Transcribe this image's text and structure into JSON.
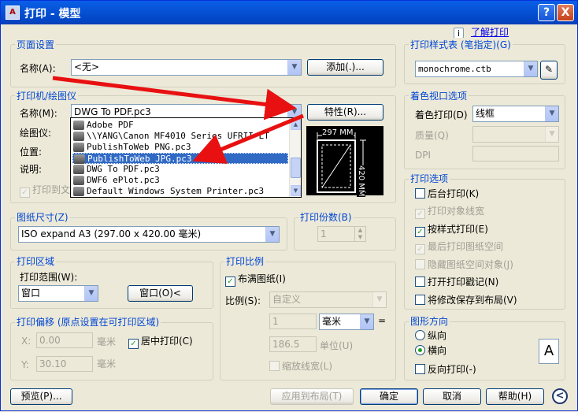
{
  "window": {
    "title": "打印 - 模型",
    "app_icon": "A",
    "min": "_",
    "close": "X"
  },
  "help": {
    "info": "i",
    "learn": "了解打印"
  },
  "page_setup": {
    "group": "页面设置",
    "name_label": "名称(A):",
    "name_value": "<无>",
    "add_button": "添加(.)..."
  },
  "printer": {
    "group": "打印机/绘图仪",
    "name_label": "名称(M):",
    "name_value": "DWG To PDF.pc3",
    "props_button": "特性(R)...",
    "plotter_label": "绘图仪:",
    "location_label": "位置:",
    "desc_label": "说明:",
    "print_to_file": "打印到文",
    "dropdown": [
      "Adobe PDF",
      "\\\\YANG\\Canon MF4010 Series UFRII LT",
      "PublishToWeb PNG.pc3",
      "PublishToWeb JPG.pc3",
      "DWG To PDF.pc3",
      "DWF6 ePlot.pc3",
      "Default Windows System Printer.pc3"
    ],
    "dropdown_selected": 3,
    "preview_width": "297 MM",
    "preview_height": "420 MM"
  },
  "paper_size": {
    "group": "图纸尺寸(Z)",
    "value": "ISO expand A3 (297.00 x 420.00 毫米)"
  },
  "copies": {
    "group": "打印份数(B)",
    "value": "1"
  },
  "plot_area": {
    "group": "打印区域",
    "range_label": "打印范围(W):",
    "range_value": "窗口",
    "window_button": "窗口(O)<"
  },
  "plot_offset": {
    "group": "打印偏移 (原点设置在可打印区域)",
    "x_label": "X:",
    "x_value": "0.00",
    "x_unit": "毫米",
    "y_label": "Y:",
    "y_value": "30.10",
    "y_unit": "毫米",
    "center": "居中打印(C)"
  },
  "plot_scale": {
    "group": "打印比例",
    "fit": "布满图纸(I)",
    "scale_label": "比例(S):",
    "scale_value": "自定义",
    "value1": "1",
    "unit1": "毫米",
    "eq": "=",
    "value2": "186.5",
    "unit2": "单位(U)",
    "lineweights": "缩放线宽(L)"
  },
  "plot_style": {
    "group": "打印样式表 (笔指定)(G)",
    "value": "monochrome.ctb"
  },
  "shaded": {
    "group": "着色视口选项",
    "shade_label": "着色打印(D)",
    "shade_value": "线框",
    "quality_label": "质量(Q)",
    "dpi_label": "DPI"
  },
  "options": {
    "group": "打印选项",
    "items": [
      {
        "label": "后台打印(K)",
        "checked": false,
        "enabled": true
      },
      {
        "label": "打印对象线宽",
        "checked": true,
        "enabled": false
      },
      {
        "label": "按样式打印(E)",
        "checked": true,
        "enabled": true
      },
      {
        "label": "最后打印图纸空间",
        "checked": true,
        "enabled": false
      },
      {
        "label": "隐藏图纸空间对象(J)",
        "checked": false,
        "enabled": false
      },
      {
        "label": "打开打印戳记(N)",
        "checked": false,
        "enabled": true
      },
      {
        "label": "将修改保存到布局(V)",
        "checked": false,
        "enabled": true
      }
    ]
  },
  "orientation": {
    "group": "图形方向",
    "portrait": "纵向",
    "landscape": "横向",
    "selected": "landscape",
    "reverse": "反向打印(-)",
    "icon": "A"
  },
  "footer": {
    "preview": "预览(P)...",
    "apply": "应用到布局(T)",
    "ok": "确定",
    "cancel": "取消",
    "help": "帮助(H)",
    "expand": "<"
  }
}
